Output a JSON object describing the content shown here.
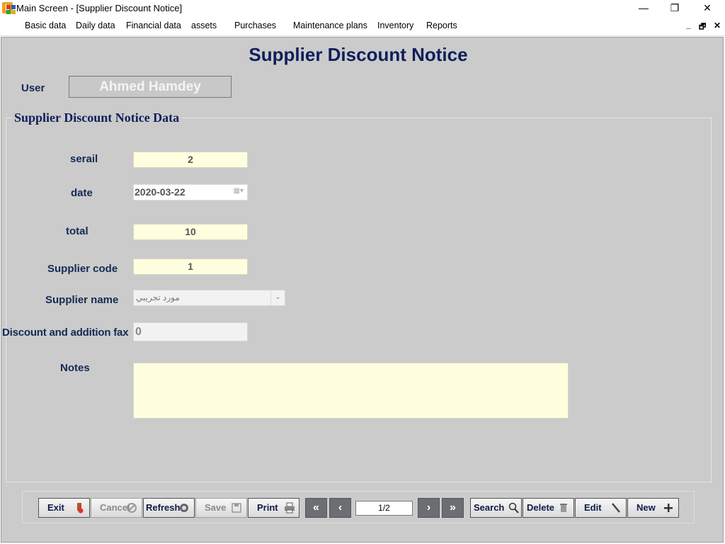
{
  "window": {
    "title": "Main Screen - [Supplier Discount Notice]",
    "minimize": "—",
    "maximize": "❐",
    "close": "✕"
  },
  "menu": {
    "items": [
      {
        "label": "Basic data"
      },
      {
        "label": "Daily data"
      },
      {
        "label": "Financial data"
      },
      {
        "label": "assets"
      },
      {
        "label": "Purchases"
      },
      {
        "label": "Maintenance plans"
      },
      {
        "label": "Inventory"
      },
      {
        "label": "Reports"
      }
    ],
    "mdi_minimize": "_",
    "mdi_restore": "🗗",
    "mdi_close": "✕"
  },
  "form": {
    "title": "Supplier Discount Notice",
    "user_label": "User",
    "user_value": "Ahmed Hamdey",
    "group_title": "Supplier Discount Notice Data",
    "fields": {
      "serial": {
        "label": "serail",
        "value": "2"
      },
      "date": {
        "label": "date",
        "value": "2020-03-22"
      },
      "total": {
        "label": "total",
        "value": "10"
      },
      "supplier_code": {
        "label": "Supplier code",
        "value": "1"
      },
      "supplier_name": {
        "label": "Supplier name",
        "value": "مورد تجريبي"
      },
      "discount_fax": {
        "label": "Discount and addition fax",
        "value": "0"
      },
      "notes": {
        "label": "Notes",
        "value": ""
      }
    }
  },
  "toolbar": {
    "exit": "Exit",
    "cancel": "Cancel",
    "refresh": "Refresh",
    "save": "Save",
    "print": "Print",
    "first": "«",
    "prev": "‹",
    "pager": "1/2",
    "next": "›",
    "last": "»",
    "search": "Search",
    "delete": "Delete",
    "edit": "Edit",
    "new": "New"
  },
  "colors": {
    "form_bg": "#cbcbcb",
    "title": "#0f1f5a",
    "field_bg": "#ffffe0",
    "nav_bg": "#6b6f73"
  }
}
